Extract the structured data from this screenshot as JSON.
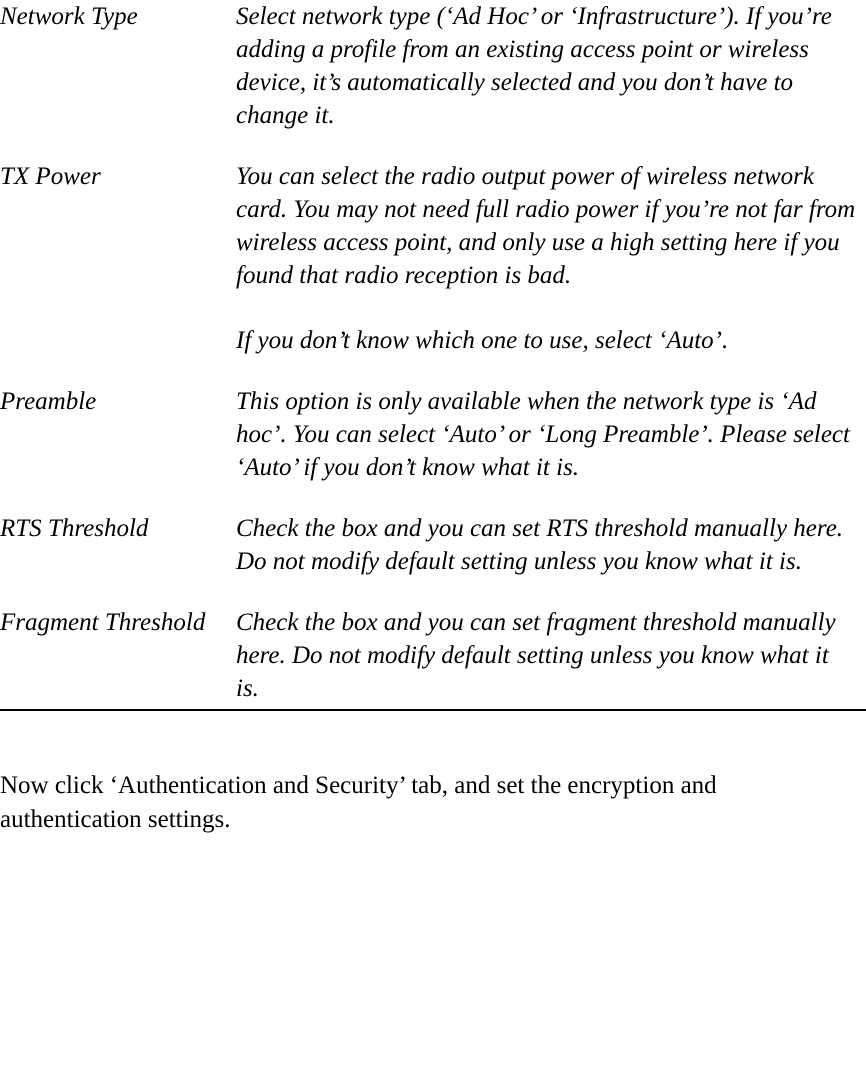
{
  "definitions": [
    {
      "term": "Network Type",
      "descriptions": [
        "Select network type (‘Ad Hoc’ or ‘Infrastructure’). If you’re adding a profile from an existing access point or wireless device, it’s automatically selected and you don’t have to change it."
      ]
    },
    {
      "term": "TX Power",
      "descriptions": [
        "You can select the radio output power of wireless network card. You may not need full radio power if you’re not far from wireless access point, and only use a high setting here if you found that radio reception is bad.",
        "If you don’t know which one to use, select ‘Auto’."
      ]
    },
    {
      "term": "Preamble",
      "descriptions": [
        "This option is only available when the network type is ‘Ad hoc’. You can select ‘Auto’ or ‘Long Preamble’. Please select ‘Auto’ if you don’t know what it is."
      ]
    },
    {
      "term": "RTS Threshold",
      "descriptions": [
        "Check the box and you can set RTS threshold manually here. Do not modify default setting unless you know what it is."
      ]
    },
    {
      "term": "Fragment Threshold",
      "descriptions": [
        "Check the box and you can set fragment threshold manually here. Do not modify default setting unless you know what it is."
      ]
    }
  ],
  "closing_text": "Now click ‘Authentication and Security’ tab, and set the encryption and authentication settings."
}
